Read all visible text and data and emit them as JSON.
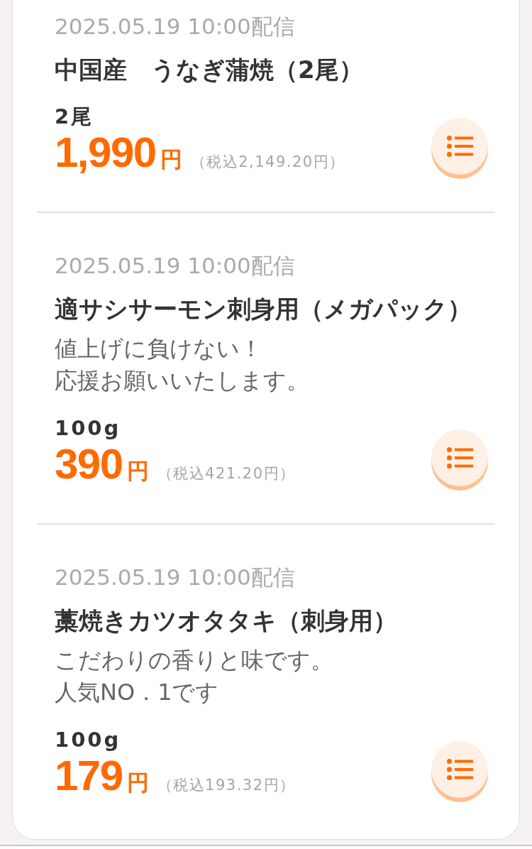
{
  "products": [
    {
      "delivery": "2025.05.19 10:00配信",
      "name": "中国産　うなぎ蒲焼（2尾）",
      "unit": "2尾",
      "price": "1,990",
      "currency": "円",
      "tax_included": "（税込2,149.20円）"
    },
    {
      "delivery": "2025.05.19 10:00配信",
      "name": "適サシサーモン刺身用（メガパック）",
      "description": [
        "値上げに負けない！",
        "応援お願いいたします。"
      ],
      "unit": "100g",
      "price": "390",
      "currency": "円",
      "tax_included": "（税込421.20円）"
    },
    {
      "delivery": "2025.05.19 10:00配信",
      "name": "藁焼きカツオタタキ（刺身用）",
      "description": [
        "こだわりの香りと味です。",
        "人気NO．1です"
      ],
      "unit": "100g",
      "price": "179",
      "currency": "円",
      "tax_included": "（税込193.32円）"
    }
  ]
}
